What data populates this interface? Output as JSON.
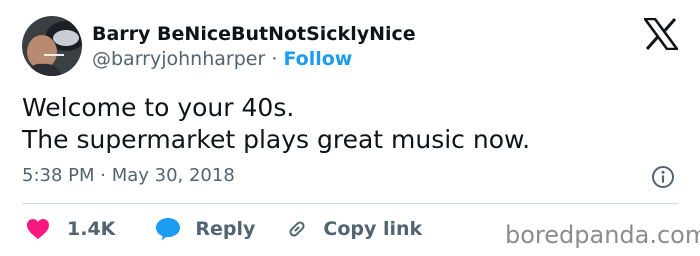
{
  "tweet": {
    "author": {
      "display_name": "Barry BeNiceButNotSicklyNice",
      "handle": "@barryjohnharper",
      "separator": "·",
      "follow_label": "Follow"
    },
    "text_lines": [
      "Welcome to your 40s.",
      "The supermarket plays great music now."
    ],
    "timestamp": "5:38 PM · May 30, 2018",
    "actions": {
      "likes_count": "1.4K",
      "reply_label": "Reply",
      "copy_link_label": "Copy link"
    }
  },
  "icons": {
    "platform_logo": "x-logo-icon",
    "info": "info-icon",
    "like": "heart-icon",
    "reply": "speech-bubble-icon",
    "copy": "link-icon"
  },
  "colors": {
    "text": "#0f1419",
    "secondary_text": "#536471",
    "link": "#1d9bf0",
    "heart": "#f91880",
    "reply_bubble": "#1d9bf0",
    "divider": "#cfd9de"
  },
  "watermark": "boredpanda.com"
}
